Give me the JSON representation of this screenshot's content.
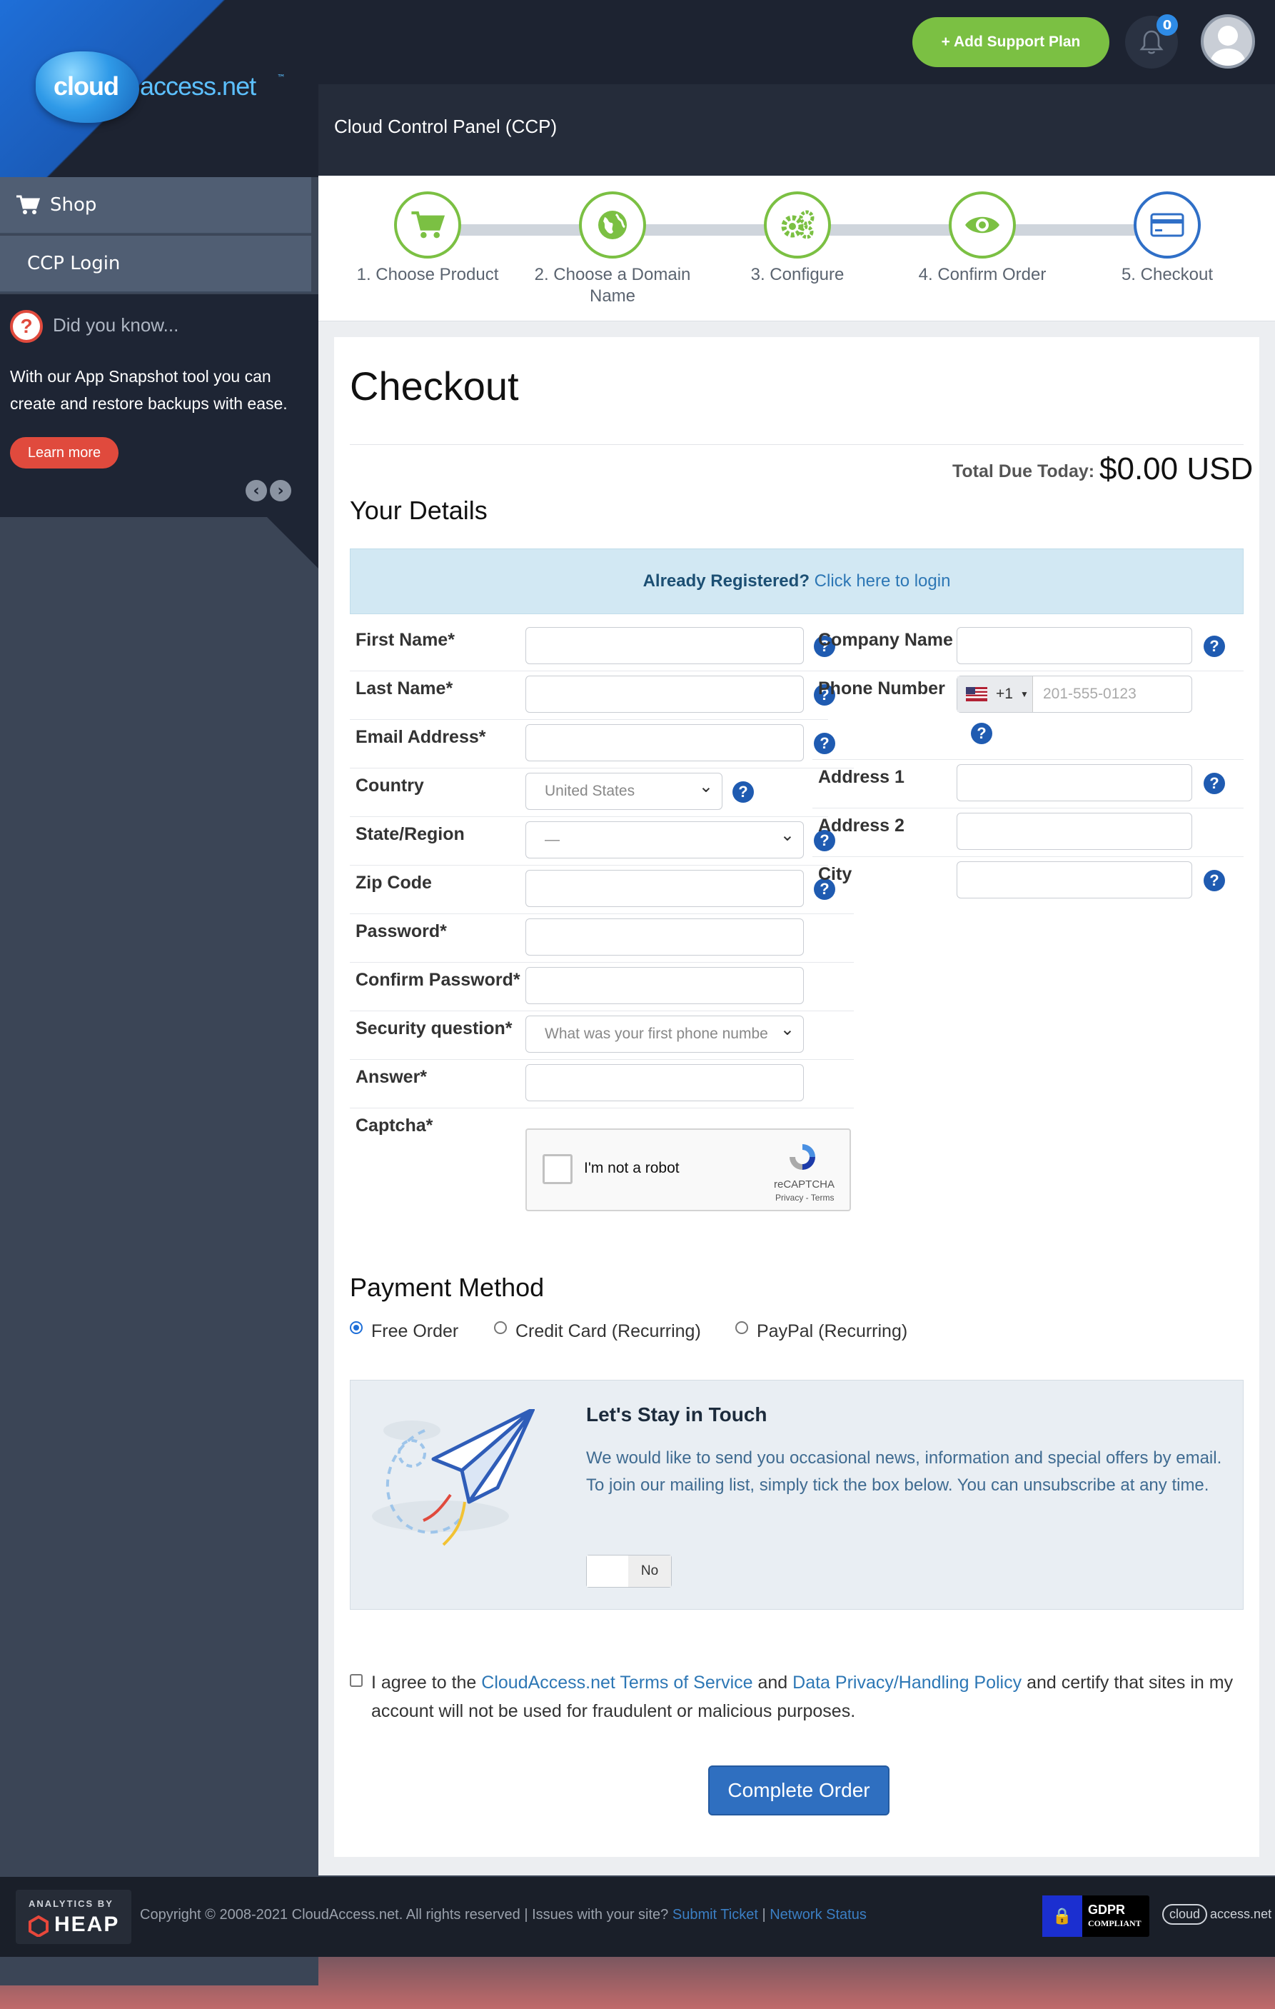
{
  "brand": {
    "logo_main": "cloud",
    "logo_rest": "access.net",
    "logo_tm": "™"
  },
  "sidebar": {
    "items": [
      {
        "label": "Shop",
        "icon": "cart-icon"
      },
      {
        "label": "CCP Login"
      }
    ],
    "tip": {
      "title": "Did you know...",
      "text": "With our App Snapshot tool you can create and restore backups with ease.",
      "button": "Learn more"
    }
  },
  "topbar": {
    "add_support_label": "Add Support Plan",
    "add_support_icon": "+",
    "notifications_count": "0"
  },
  "panel_title": "Cloud Control Panel (CCP)",
  "steps": [
    {
      "label": "1. Choose Product",
      "icon": "cart-icon",
      "active": false
    },
    {
      "label": "2. Choose a Domain Name",
      "icon": "globe-icon",
      "active": false
    },
    {
      "label": "3. Configure",
      "icon": "gears-icon",
      "active": false
    },
    {
      "label": "4. Confirm Order",
      "icon": "eye-icon",
      "active": false
    },
    {
      "label": "5. Checkout",
      "icon": "credit-card-icon",
      "active": true
    }
  ],
  "checkout": {
    "title": "Checkout",
    "total_label": "Total Due Today:",
    "total_amount": "$0.00 USD",
    "details_title": "Your Details",
    "already_registered": "Already Registered?",
    "login_link": "Click here to login"
  },
  "form_left": {
    "first_name": {
      "label": "First Name*",
      "value": ""
    },
    "last_name": {
      "label": "Last Name*",
      "value": ""
    },
    "email": {
      "label": "Email Address*",
      "value": ""
    },
    "country": {
      "label": "Country",
      "value": "United States"
    },
    "state": {
      "label": "State/Region",
      "value": "—"
    },
    "zip": {
      "label": "Zip Code",
      "value": ""
    },
    "password": {
      "label": "Password*",
      "value": ""
    },
    "confirm_password": {
      "label": "Confirm Password*",
      "value": ""
    },
    "security_question": {
      "label": "Security question*",
      "value": "What was your first phone numbe"
    },
    "answer": {
      "label": "Answer*",
      "value": ""
    },
    "captcha": {
      "label": "Captcha*"
    }
  },
  "form_right": {
    "company": {
      "label": "Company Name",
      "value": ""
    },
    "phone": {
      "label": "Phone Number",
      "country_code": "+1",
      "placeholder": "201-555-0123"
    },
    "address1": {
      "label": "Address 1",
      "value": ""
    },
    "address2": {
      "label": "Address 2",
      "value": ""
    },
    "city": {
      "label": "City",
      "value": ""
    }
  },
  "captcha": {
    "checkbox_label": "I'm not a robot",
    "brand": "reCAPTCHA",
    "links": "Privacy - Terms"
  },
  "payment": {
    "title": "Payment Method",
    "options": [
      {
        "label": "Free Order",
        "selected": true
      },
      {
        "label": "Credit Card (Recurring)",
        "selected": false
      },
      {
        "label": "PayPal (Recurring)",
        "selected": false
      }
    ]
  },
  "stay_in_touch": {
    "title": "Let's Stay in Touch",
    "text": "We would like to send you occasional news, information and special offers by email. To join our mailing list, simply tick the box below. You can unsubscribe at any time.",
    "toggle_label": "No"
  },
  "agreement": {
    "prefix": "I agree to the ",
    "tos_link": "CloudAccess.net Terms of Service",
    "middle": " and ",
    "privacy_link": "Data Privacy/Handling Policy",
    "suffix": " and certify that sites in my account will not be used for fraudulent or malicious purposes."
  },
  "complete_button": "Complete Order",
  "footer": {
    "heap_top": "ANALYTICS BY",
    "heap_word": "HEAP",
    "copyright": "Copyright © 2008-2021 CloudAccess.net. All rights reserved | Issues with your site?",
    "submit_ticket": "Submit Ticket",
    "separator": "|",
    "network_status": "Network Status",
    "gdpr_title": "GDPR",
    "gdpr_sub": "COMPLIANT",
    "footer_logo_a": "cloud",
    "footer_logo_b": "access.net"
  },
  "colors": {
    "accent_green": "#7bc043",
    "accent_blue": "#2f6fc0",
    "danger_red": "#e04a3d",
    "sidebar_bg": "#3b4556",
    "topbar_bg": "#1d2331"
  }
}
